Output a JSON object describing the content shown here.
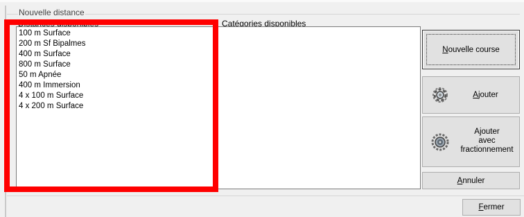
{
  "group": {
    "title": "Nouvelle distance"
  },
  "headers": {
    "distances": "Distances disponibles",
    "categories": "Catégories disponibles"
  },
  "distances": [
    "100 m Surface",
    "200 m Sf Bipalmes",
    "400 m Surface",
    "800 m Surface",
    "50 m Apnée",
    "400 m Immersion",
    "4 x 100 m Surface",
    "4 x 200 m Surface"
  ],
  "buttons": {
    "new_race": {
      "first": "N",
      "rest": "ouvelle course"
    },
    "add": {
      "first": "A",
      "rest": "jouter"
    },
    "add_split": "Ajouter\navec\nfractionnement",
    "cancel": {
      "first": "A",
      "rest": "nnuler"
    },
    "close": {
      "first": "F",
      "rest": "ermer"
    }
  },
  "icons": {
    "add": "gear-icon",
    "add_split": "gear-split-icon"
  },
  "colors": {
    "highlight": "#ff0000"
  }
}
